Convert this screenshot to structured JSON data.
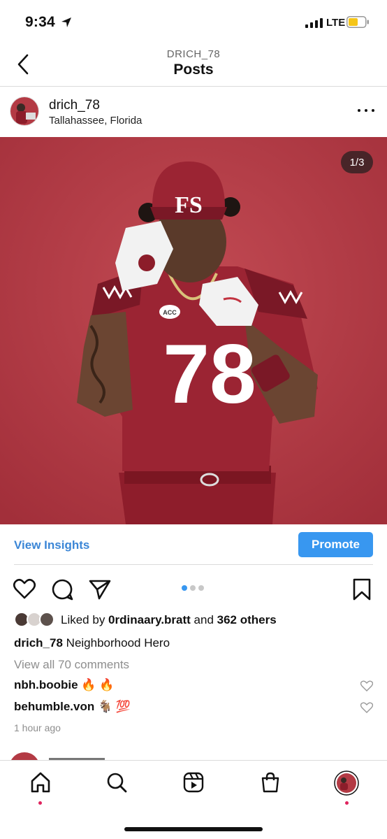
{
  "status_bar": {
    "time": "9:34",
    "network": "LTE",
    "battery_color": "#f5c518"
  },
  "header": {
    "username": "DRICH_78",
    "title": "Posts"
  },
  "post": {
    "username": "drich_78",
    "location": "Tallahassee, Florida",
    "image_counter": "1/3",
    "image_position": {
      "current": 1,
      "total": 3
    },
    "jersey_number": "78",
    "cap_logo": "FS",
    "patch": "ACC",
    "background_color": "#b33a44"
  },
  "insights": {
    "view_insights_label": "View Insights",
    "promote_label": "Promote"
  },
  "likes": {
    "prefix": "Liked by ",
    "liked_by_user": "0rdinaary.bratt",
    "and": " and ",
    "others": "362 others"
  },
  "caption": {
    "username": "drich_78",
    "text": "Neighborhood Hero"
  },
  "comments_link": "View all 70 comments",
  "comments": [
    {
      "username": "nbh.boobie",
      "text": "🔥 🔥"
    },
    {
      "username": "behumble.von",
      "text": "🐐 💯"
    }
  ],
  "timestamp": "1 hour ago",
  "tabs": [
    "home",
    "search",
    "reels",
    "shop",
    "profile"
  ],
  "colors": {
    "accent_blue": "#3897f0",
    "link_blue": "#3b86d6",
    "notification_red": "#e0245e"
  }
}
